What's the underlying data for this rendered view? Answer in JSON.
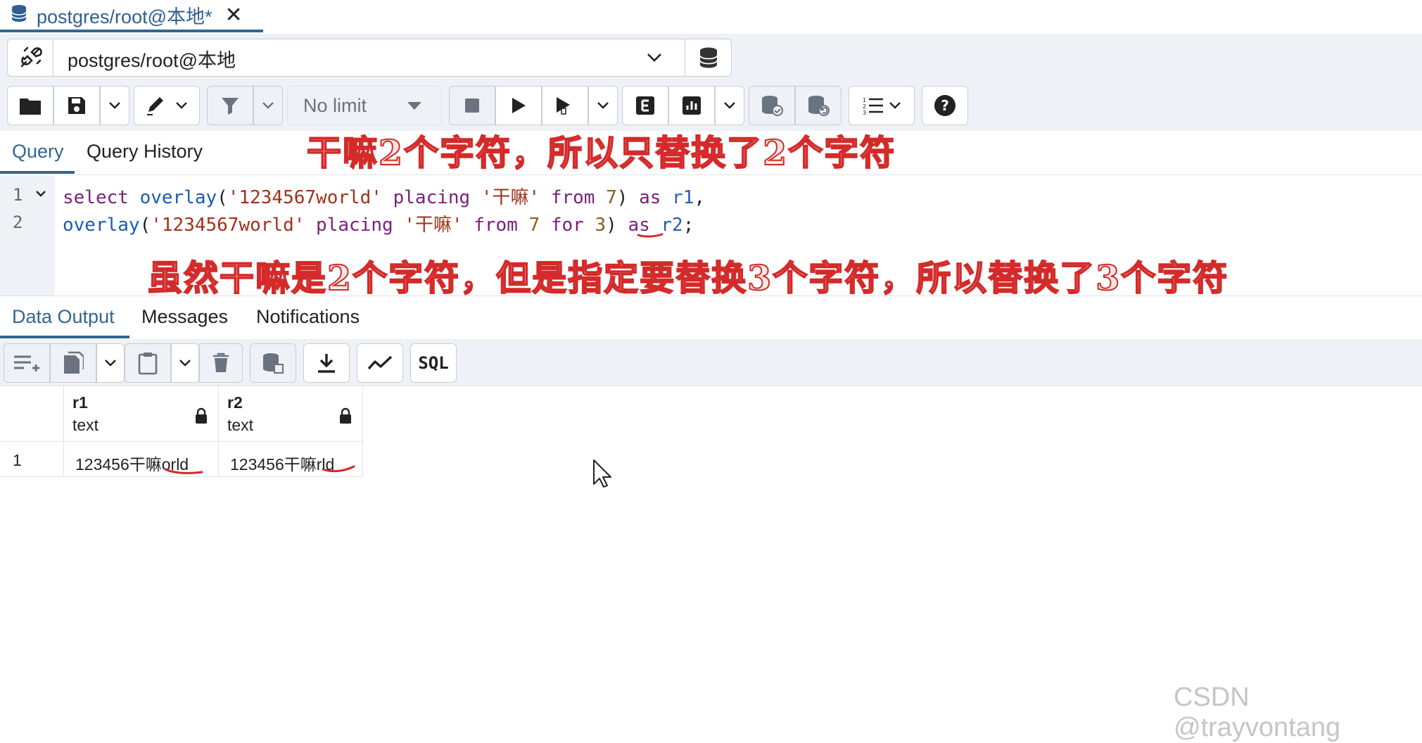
{
  "doc_tab": {
    "title": "postgres/root@本地*"
  },
  "connection": {
    "label": "postgres/root@本地"
  },
  "toolbar": {
    "limit_label": "No limit"
  },
  "query_tabs": [
    {
      "label": "Query"
    },
    {
      "label": "Query History"
    }
  ],
  "editor": {
    "line_numbers": [
      "1",
      "2"
    ],
    "line1": {
      "kw1": "select",
      "fn": "overlay",
      "p1": "(",
      "str1": "'1234567world'",
      "kw2": "placing",
      "str2": "'干嘛'",
      "kw3": "from",
      "num": "7",
      "p2": ")",
      "kw4": "as",
      "alias": "r1",
      "end": ","
    },
    "line2": {
      "fn": "overlay",
      "p1": "(",
      "str1": "'1234567world'",
      "kw2": "placing",
      "str2": "'干嘛'",
      "kw3": "from",
      "num1": "7",
      "kw4": "for",
      "num2": "3",
      "p2": ")",
      "kw5": "as",
      "alias": "r2",
      "end": ";"
    }
  },
  "annotations": {
    "top": "干嘛2个字符，所以只替换了2个字符",
    "bottom": "虽然干嘛是2个字符，但是指定要替换3个字符，所以替换了3个字符",
    "color": "#d42a2a"
  },
  "output_tabs": [
    {
      "label": "Data Output"
    },
    {
      "label": "Messages"
    },
    {
      "label": "Notifications"
    }
  ],
  "output_toolbar": {
    "sql_label": "SQL"
  },
  "grid": {
    "columns": [
      {
        "name": "r1",
        "type": "text"
      },
      {
        "name": "r2",
        "type": "text"
      }
    ],
    "rows": [
      {
        "num": "1",
        "cells": [
          "123456干嘛orld",
          "123456干嘛rld"
        ]
      }
    ]
  },
  "watermark": "CSDN @trayvontang",
  "colors": {
    "accent": "#326690",
    "toolbar_bg": "#eef1f5",
    "border": "#c9ced6"
  }
}
